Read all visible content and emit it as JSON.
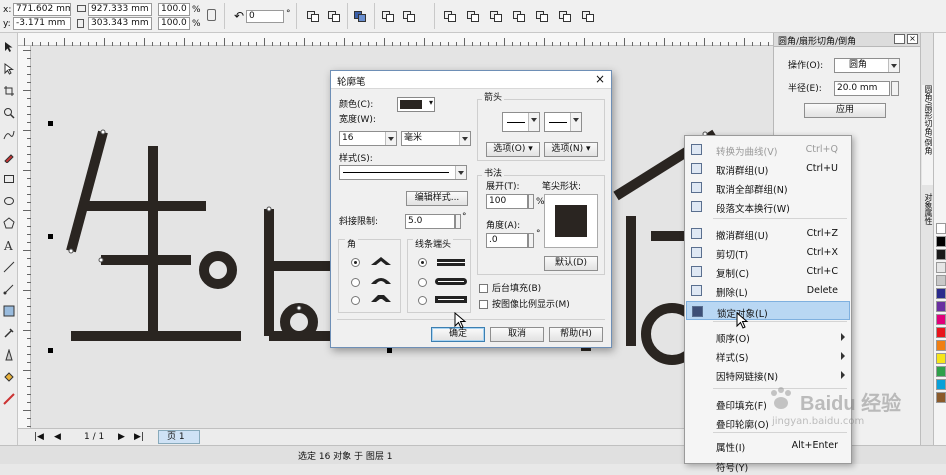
{
  "property_bar": {
    "x": "771.602 mm",
    "y": "-3.171 mm",
    "width": "927.333 mm",
    "height": "303.343 mm",
    "scale_x": "100.0",
    "scale_y": "100.0",
    "percent": "%",
    "rotation": "0"
  },
  "coord_labels": {
    "x": "x:",
    "y": "y:"
  },
  "docker": {
    "title": "圆角/扇形切角/倒角",
    "operation_label": "操作(O):",
    "operation_value": "圆角",
    "radius_label": "半径(E):",
    "radius_value": "20.0 mm",
    "apply_label": "应用",
    "vertical_tab": "圆角/扇形切角/倒角",
    "vertical_tab2": "对象属性"
  },
  "dialog": {
    "title": "轮廓笔",
    "color_label": "颜色(C):",
    "width_label": "宽度(W):",
    "width_value": "16",
    "unit_value": "毫米",
    "style_label": "样式(S):",
    "edit_style_button": "编辑样式...",
    "miter_label": "斜接限制:",
    "miter_value": "5.0",
    "corners_label": "角",
    "line_caps_label": "线条端头",
    "arrows_label": "箭头",
    "options_left": "选项(O)",
    "options_right": "选项(N)",
    "calligraphy_label": "书法",
    "stretch_label": "展开(T):",
    "stretch_value": "100",
    "angle_label": "角度(A):",
    "angle_value": ".0",
    "nib_shape_label": "笔尖形状:",
    "default_button": "默认(D)",
    "behind_fill": "后台填充(B)",
    "scale_with_image": "按图像比例显示(M)",
    "ok_button": "确定",
    "cancel_button": "取消",
    "help_button": "帮助(H)",
    "percent_unit": "%",
    "degree_unit": "°"
  },
  "context_menu": {
    "items": [
      {
        "label": "转换为曲线(V)",
        "shortcut": "Ctrl+Q",
        "icon": "convert-curve-icon"
      },
      {
        "label": "取消群组(U)",
        "shortcut": "Ctrl+U",
        "icon": "ungroup-icon"
      },
      {
        "label": "取消全部群组(N)",
        "shortcut": "",
        "icon": "ungroup-all-icon"
      },
      {
        "label": "段落文本换行(W)",
        "shortcut": "",
        "icon": "wrap-text-icon"
      },
      {
        "label": "撤消群组(U)",
        "shortcut": "Ctrl+Z",
        "icon": "undo-icon"
      },
      {
        "label": "剪切(T)",
        "shortcut": "Ctrl+X",
        "icon": "cut-icon"
      },
      {
        "label": "复制(C)",
        "shortcut": "Ctrl+C",
        "icon": "copy-icon"
      },
      {
        "label": "删除(L)",
        "shortcut": "Delete",
        "icon": "delete-icon"
      },
      {
        "label": "锁定对象(L)",
        "shortcut": "",
        "icon": "lock-icon"
      },
      {
        "label": "顺序(O)",
        "shortcut": "",
        "icon": ""
      },
      {
        "label": "样式(S)",
        "shortcut": "",
        "icon": ""
      },
      {
        "label": "因特网链接(N)",
        "shortcut": "",
        "icon": ""
      },
      {
        "label": "叠印填充(F)",
        "shortcut": "",
        "icon": ""
      },
      {
        "label": "叠印轮廓(O)",
        "shortcut": "",
        "icon": ""
      },
      {
        "label": "属性(I)",
        "shortcut": "Alt+Enter",
        "icon": ""
      },
      {
        "label": "符号(Y)",
        "shortcut": "",
        "icon": ""
      }
    ]
  },
  "page_nav": {
    "page_count": "1 / 1",
    "page_tab": "页 1"
  },
  "status": {
    "text": "选定 16 对象 于 图层 1"
  },
  "watermark": {
    "text": "Baidu 经验",
    "url": "jingyan.baidu.com"
  },
  "palette_colors": [
    "#ffffff",
    "#000000",
    "#1a1a1a",
    "#e6e6e6",
    "#c8c8c8",
    "#2b2b8c",
    "#6a2fa0",
    "#e0007a",
    "#e8141b",
    "#f07f14",
    "#f6e51b",
    "#2fa04a",
    "#0aa0d8",
    "#8a5a2b"
  ]
}
